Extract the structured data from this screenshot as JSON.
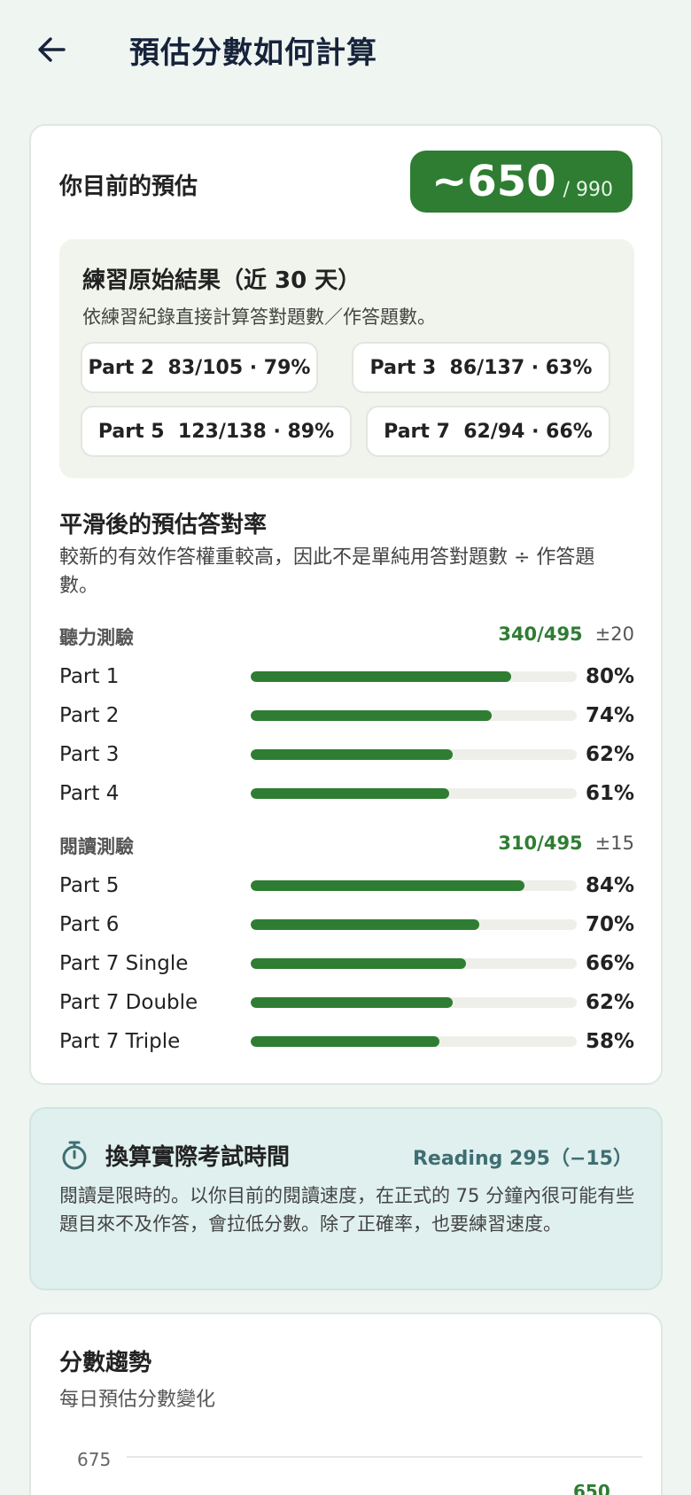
{
  "header": {
    "title": "預估分數如何計算"
  },
  "estimate": {
    "label": "你目前的預估",
    "score": "~650",
    "max": "/ 990"
  },
  "raw": {
    "title": "練習原始結果（近 30 天）",
    "subtitle": "依練習紀錄直接計算答對題數／作答題數。",
    "chips": [
      {
        "text": "Part 2  83/105 · 79%"
      },
      {
        "text": "Part 3  86/137 · 63%"
      },
      {
        "text": "Part 5  123/138 · 89%"
      },
      {
        "text": "Part 7  62/94 · 66%"
      }
    ]
  },
  "smoothed": {
    "title": "平滑後的預估答對率",
    "subtitle": "較新的有效作答權重較高，因此不是單純用答對題數 ÷ 作答題數。",
    "listening": {
      "name": "聽力測驗",
      "score": "340/495",
      "margin": "±20",
      "parts": [
        {
          "label": "Part 1",
          "pct": 80,
          "pct_text": "80%"
        },
        {
          "label": "Part 2",
          "pct": 74,
          "pct_text": "74%"
        },
        {
          "label": "Part 3",
          "pct": 62,
          "pct_text": "62%"
        },
        {
          "label": "Part 4",
          "pct": 61,
          "pct_text": "61%"
        }
      ]
    },
    "reading": {
      "name": "閱讀測驗",
      "score": "310/495",
      "margin": "±15",
      "parts": [
        {
          "label": "Part 5",
          "pct": 84,
          "pct_text": "84%"
        },
        {
          "label": "Part 6",
          "pct": 70,
          "pct_text": "70%"
        },
        {
          "label": "Part 7 Single",
          "pct": 66,
          "pct_text": "66%"
        },
        {
          "label": "Part 7 Double",
          "pct": 62,
          "pct_text": "62%"
        },
        {
          "label": "Part 7 Triple",
          "pct": 58,
          "pct_text": "58%"
        }
      ]
    }
  },
  "timing": {
    "title": "換算實際考試時間",
    "right": "Reading 295（−15）",
    "body": "閱讀是限時的。以你目前的閱讀速度，在正式的 75 分鐘內很可能有些題目來不及作答，會拉低分數。除了正確率，也要練習速度。"
  },
  "trend": {
    "title": "分數趨勢",
    "subtitle": "每日預估分數變化",
    "y_tick": "675",
    "last_value": "650"
  },
  "colors": {
    "accent": "#2e7d32",
    "timing_bg": "#dff0ee",
    "page_bg": "#eff5f1"
  }
}
